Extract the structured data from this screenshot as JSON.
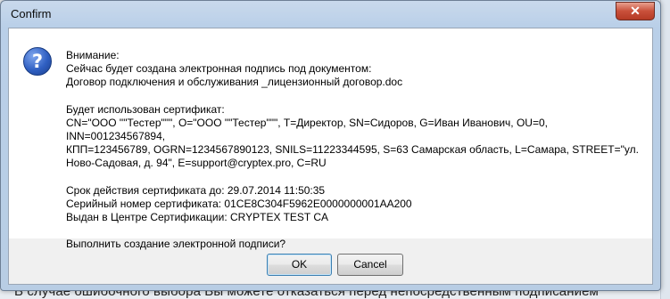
{
  "background": {
    "text": "В случае ошибочного выбора Вы можете отказаться перед непосредственным подписанием"
  },
  "dialog": {
    "title": "Confirm",
    "close_label": "✕",
    "icon": "question-icon",
    "lines": {
      "attention": "Внимание:",
      "will_create": "Сейчас будет создана электронная подпись под документом:",
      "document_name": "Договор подключения и обслуживания _лицензионный договор.doc",
      "cert_used": "Будет использован сертификат:",
      "cert_line1": "CN=\"ООО \"\"Тестер\"\"\", O=\"ООО \"\"Тестер\"\"\", T=Директор, SN=Сидоров, G=Иван Иванович, OU=0, INN=001234567894,",
      "cert_line2": "КПП=123456789, OGRN=1234567890123, SNILS=11223344595, S=63 Самарская область, L=Самара, STREET=\"ул.",
      "cert_line3": "Ново-Садовая, д. 94\", E=support@cryptex.pro, C=RU",
      "valid_until": "Срок действия сертификата до: 29.07.2014 11:50:35",
      "serial": "Серийный номер сертификата: 01CE8C304F5962E0000000001AA200",
      "issued_by": "Выдан в Центре Сертификации: CRYPTEX TEST CA",
      "question": "Выполнить создание электронной подписи?"
    },
    "buttons": {
      "ok": "OK",
      "cancel": "Cancel"
    }
  },
  "colors": {
    "frame": "#b9cfe8",
    "close": "#c9503a",
    "default_button_border": "#3c7fb1"
  }
}
